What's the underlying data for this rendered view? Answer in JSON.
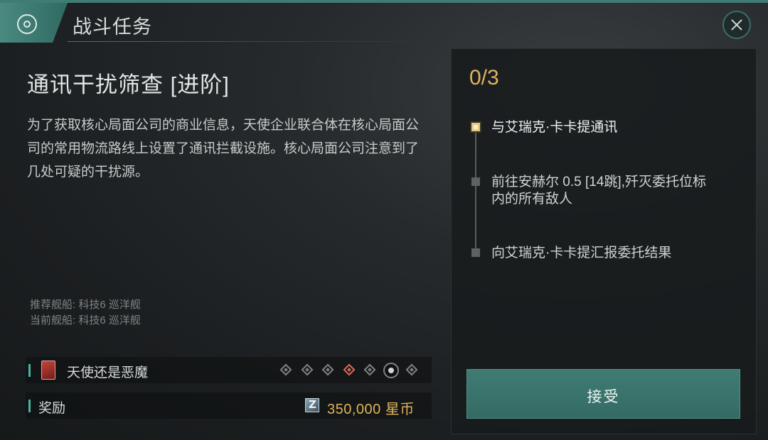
{
  "header": {
    "title": "战斗任务",
    "icon": "mission-target-icon"
  },
  "mission": {
    "title": "通讯干扰筛查 [进阶]",
    "description": "为了获取核心局面公司的商业信息，天使企业联合体在核心局面公司的常用物流路线上设置了通讯拦截设施。核心局面公司注意到了几处可疑的干扰源。",
    "recommended_ship": "推荐舰船: 科技6 巡洋舰",
    "current_ship": "当前舰船: 科技6 巡洋舰"
  },
  "series": {
    "name": "天使还是恶魔",
    "icon": "red-card-icon",
    "steps_total": 7,
    "active_step": 4,
    "current_step": 6
  },
  "reward": {
    "label": "奖励",
    "amount": "350,000",
    "currency": "星币",
    "icon": "coin-icon"
  },
  "objectives": {
    "progress": "0/3",
    "items": [
      {
        "text": "与艾瑞克·卡卡提通讯",
        "active": true
      },
      {
        "text": "前往安赫尔 0.5 [14跳],歼灭委托位标内的所有敌人",
        "active": false
      },
      {
        "text": "向艾瑞克·卡卡提汇报委托结果",
        "active": false
      }
    ]
  },
  "accept_button": "接受",
  "colors": {
    "accent": "#3f7c74",
    "gold": "#e0b35a",
    "active_diamond": "#d86a5c"
  }
}
